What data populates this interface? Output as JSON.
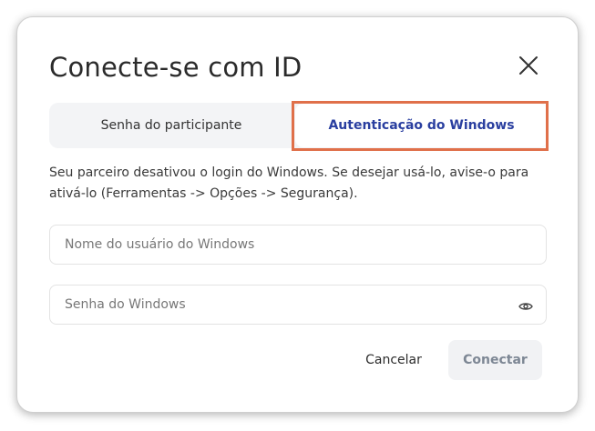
{
  "dialog": {
    "title": "Conecte-se com ID",
    "close_icon": "close-icon"
  },
  "tabs": [
    {
      "label": "Senha do participante",
      "active": false
    },
    {
      "label": "Autenticação do Windows",
      "active": true
    }
  ],
  "info_text": "Seu parceiro desativou o login do Windows. Se desejar usá-lo, avise-o para ativá-lo (Ferramentas -> Opções -> Segurança).",
  "fields": {
    "username": {
      "placeholder": "Nome do usuário do Windows",
      "value": ""
    },
    "password": {
      "placeholder": "Senha do Windows",
      "value": "",
      "icon": "eye-icon"
    }
  },
  "buttons": {
    "cancel": "Cancelar",
    "connect": "Conectar"
  },
  "colors": {
    "active_tab_text": "#2a3fa0",
    "highlight_border": "#e0704a",
    "tab_background": "#f3f4f6"
  }
}
